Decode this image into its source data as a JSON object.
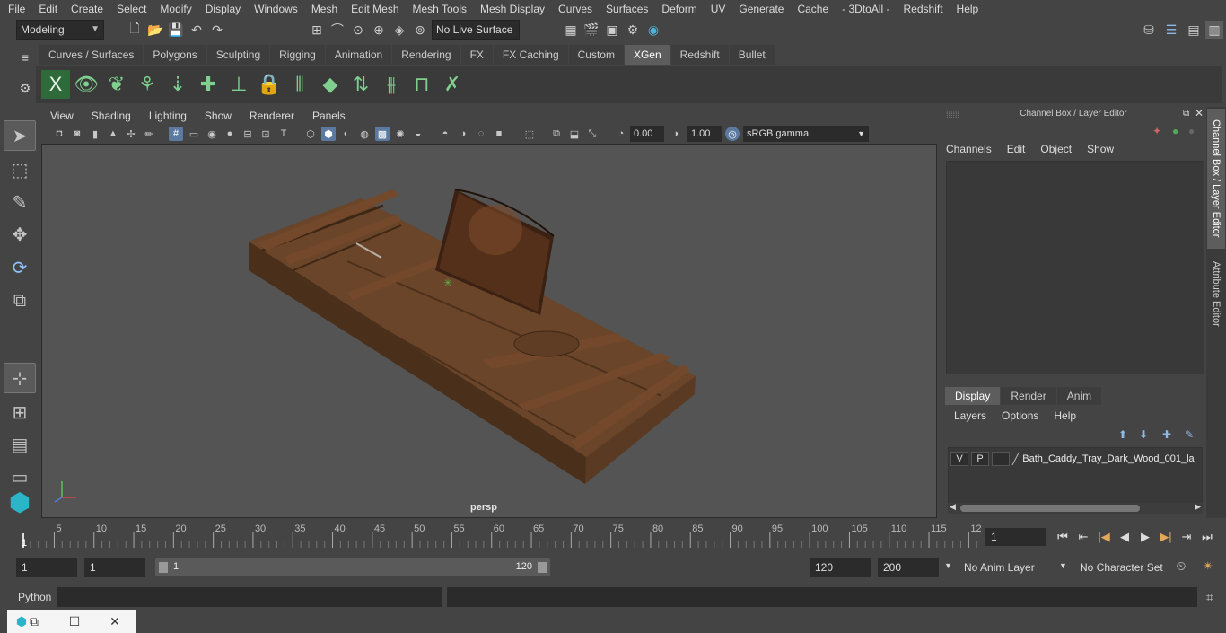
{
  "menubar": [
    "File",
    "Edit",
    "Create",
    "Select",
    "Modify",
    "Display",
    "Windows",
    "Mesh",
    "Edit Mesh",
    "Mesh Tools",
    "Mesh Display",
    "Curves",
    "Surfaces",
    "Deform",
    "UV",
    "Generate",
    "Cache",
    "- 3DtoAll -",
    "Redshift",
    "Help"
  ],
  "statusline": {
    "mode": "Modeling",
    "live_surface": "No Live Surface"
  },
  "shelf_tabs": [
    "Curves / Surfaces",
    "Polygons",
    "Sculpting",
    "Rigging",
    "Animation",
    "Rendering",
    "FX",
    "FX Caching",
    "Custom",
    "XGen",
    "Redshift",
    "Bullet"
  ],
  "shelf_active": "XGen",
  "viewport": {
    "menu": [
      "View",
      "Shading",
      "Lighting",
      "Show",
      "Renderer",
      "Panels"
    ],
    "exposure": "0.00",
    "gamma": "1.00",
    "color_space": "sRGB gamma",
    "camera_label": "persp"
  },
  "channel_box": {
    "title": "Channel Box / Layer Editor",
    "menu": [
      "Channels",
      "Edit",
      "Object",
      "Show"
    ]
  },
  "layer_editor": {
    "tabs": [
      "Display",
      "Render",
      "Anim"
    ],
    "menu": [
      "Layers",
      "Options",
      "Help"
    ],
    "layer": {
      "v": "V",
      "p": "P",
      "name": "Bath_Caddy_Tray_Dark_Wood_001_la"
    }
  },
  "side_tabs": [
    "Channel Box / Layer Editor",
    "Attribute Editor"
  ],
  "timeline": {
    "ticks": [
      "5",
      "10",
      "15",
      "20",
      "25",
      "30",
      "35",
      "40",
      "45",
      "50",
      "55",
      "60",
      "65",
      "70",
      "75",
      "80",
      "85",
      "90",
      "95",
      "100",
      "105",
      "110",
      "115",
      "12"
    ],
    "start_label": "1",
    "current_frame": "1"
  },
  "range": {
    "start": "1",
    "playback_start": "1",
    "slider_start": "1",
    "slider_end": "120",
    "playback_end": "120",
    "end": "200",
    "anim_layer": "No Anim Layer",
    "character_set": "No Character Set"
  },
  "cmdline": {
    "label": "Python"
  }
}
